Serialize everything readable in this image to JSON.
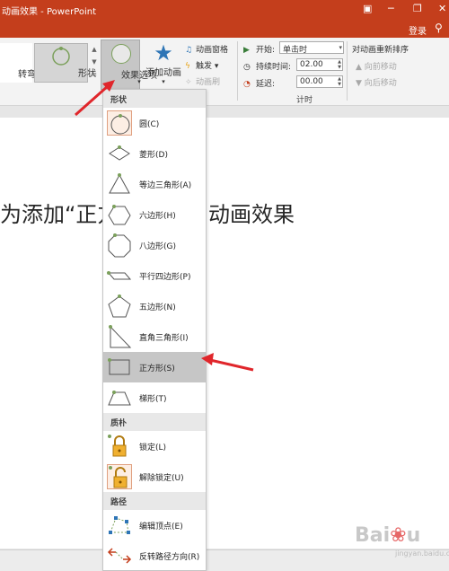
{
  "window": {
    "title": "动画效果 - PowerPoint",
    "login": "登录"
  },
  "ribbon": {
    "gallery": {
      "swivel": "转弯",
      "shape": "形状"
    },
    "effect_options": {
      "label": "效果选项",
      "arrow": "▾"
    },
    "add_animation": {
      "label": "添加动画",
      "arrow": "▾"
    },
    "advanced": {
      "pane": "动画窗格",
      "trigger": "触发",
      "painter": "动画刷"
    },
    "timing": {
      "start_label": "开始:",
      "start_value": "单击时",
      "duration_label": "持续时间:",
      "duration_value": "02.00",
      "delay_label": "延迟:",
      "delay_value": "00.00",
      "group_name": "计时"
    },
    "reorder": {
      "title": "对动画重新排序",
      "earlier": "向前移动",
      "later": "向后移动"
    }
  },
  "slide": {
    "text_left": "为添加“正方",
    "text_right": "动画效果"
  },
  "dropdown": {
    "sections": [
      {
        "header": "形状",
        "items": [
          {
            "label": "圆(C)",
            "icon": "circle-shape-icon",
            "boxed": true,
            "selected": false
          },
          {
            "label": "菱形(D)",
            "icon": "diamond-shape-icon",
            "boxed": false,
            "selected": false
          },
          {
            "label": "等边三角形(A)",
            "icon": "triangle-shape-icon",
            "boxed": false,
            "selected": false
          },
          {
            "label": "六边形(H)",
            "icon": "hexagon-shape-icon",
            "boxed": false,
            "selected": false
          },
          {
            "label": "八边形(G)",
            "icon": "octagon-shape-icon",
            "boxed": false,
            "selected": false
          },
          {
            "label": "平行四边形(P)",
            "icon": "parallelogram-shape-icon",
            "boxed": false,
            "selected": false
          },
          {
            "label": "五边形(N)",
            "icon": "pentagon-shape-icon",
            "boxed": false,
            "selected": false
          },
          {
            "label": "直角三角形(I)",
            "icon": "right-triangle-shape-icon",
            "boxed": false,
            "selected": false
          },
          {
            "label": "正方形(S)",
            "icon": "square-shape-icon",
            "boxed": false,
            "selected": true
          },
          {
            "label": "梯形(T)",
            "icon": "trapezoid-shape-icon",
            "boxed": false,
            "selected": false
          }
        ]
      },
      {
        "header": "质朴",
        "items": [
          {
            "label": "锁定(L)",
            "icon": "lock-icon",
            "boxed": false,
            "selected": false
          },
          {
            "label": "解除锁定(U)",
            "icon": "unlock-icon",
            "boxed": true,
            "selected": false
          }
        ]
      },
      {
        "header": "路径",
        "items": [
          {
            "label": "编辑顶点(E)",
            "icon": "edit-points-icon",
            "boxed": false,
            "selected": false
          },
          {
            "label": "反转路径方向(R)",
            "icon": "reverse-path-icon",
            "boxed": false,
            "selected": false
          }
        ]
      }
    ]
  },
  "watermark": {
    "text": "Baidu经验",
    "sub": "jingyan.baidu.com"
  },
  "colors": {
    "titlebar": "#c43e1c",
    "arrow": "#e0262b",
    "accent": "#7ba05b"
  }
}
